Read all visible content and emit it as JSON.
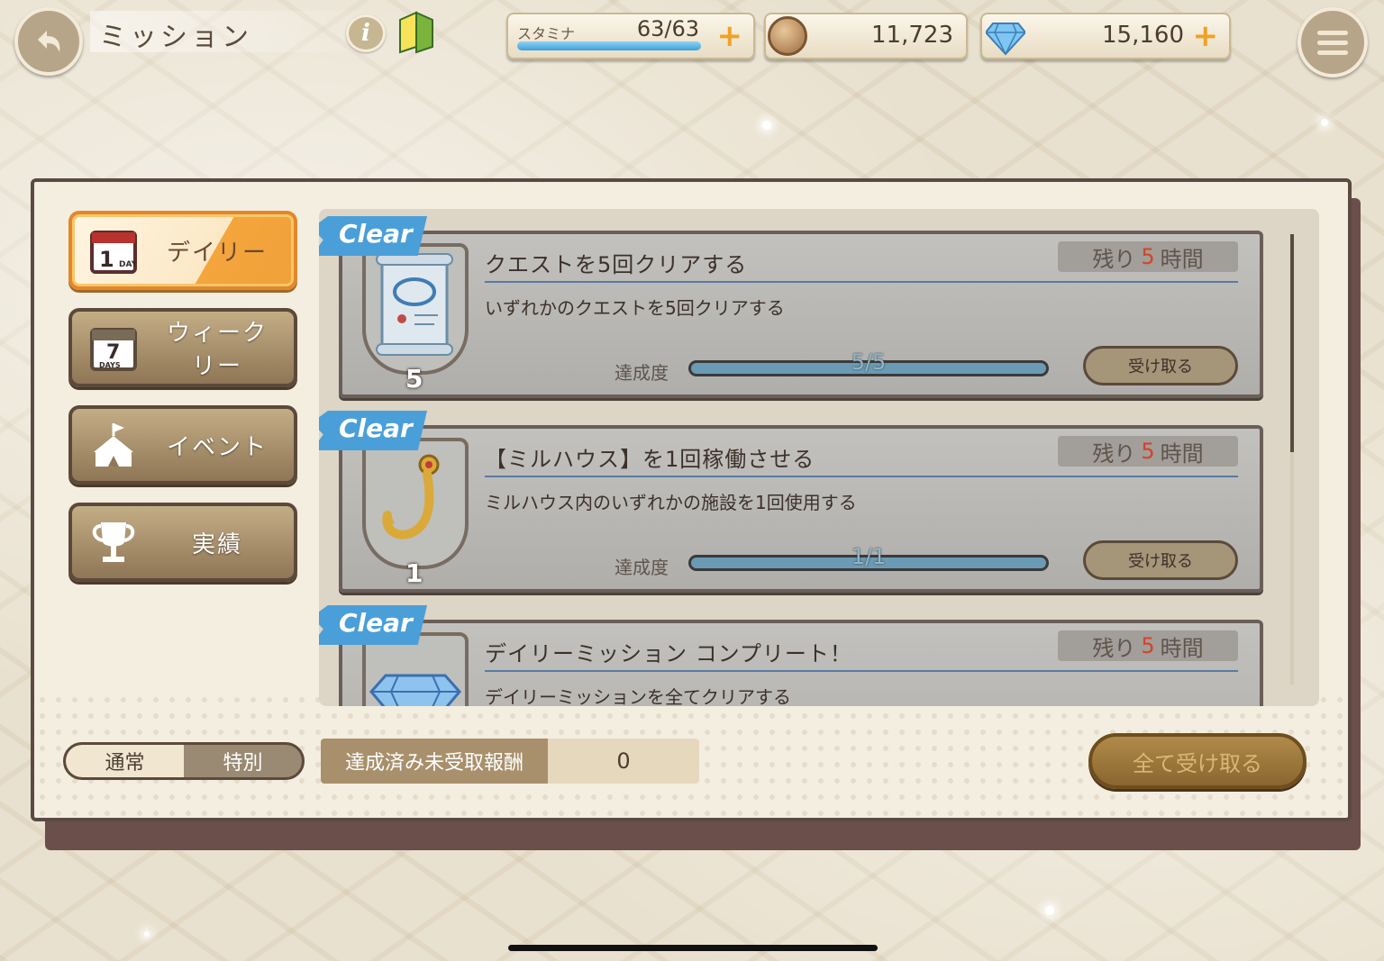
{
  "header": {
    "title": "ミッション",
    "stamina_label": "スタミナ",
    "stamina_value": "63/63",
    "stamina_fraction": 1.0,
    "coins": "11,723",
    "gems": "15,160",
    "plus": "+"
  },
  "tabs": [
    {
      "label": "デイリー",
      "active": true
    },
    {
      "label": "ウィークリー",
      "active": false
    },
    {
      "label": "イベント",
      "active": false
    },
    {
      "label": "実績",
      "active": false
    }
  ],
  "tab_icon_text": {
    "daily_day": "1",
    "daily_unit": "DAY",
    "weekly_day": "7",
    "weekly_unit": "DAYS"
  },
  "missions": [
    {
      "clear": "Clear",
      "title": "クエストを5回クリアする",
      "remain_prefix": "残り",
      "remain_num": "5",
      "remain_suffix": "時間",
      "desc": "いずれかのクエストを5回クリアする",
      "progress_label": "達成度",
      "progress_text": "5/5",
      "progress_fraction": 1.0,
      "reward_count": "5",
      "reward_icon": "scroll-icon",
      "button": "受け取る"
    },
    {
      "clear": "Clear",
      "title": "【ミルハウス】を1回稼働させる",
      "remain_prefix": "残り",
      "remain_num": "5",
      "remain_suffix": "時間",
      "desc": "ミルハウス内のいずれかの施設を1回使用する",
      "progress_label": "達成度",
      "progress_text": "1/1",
      "progress_fraction": 1.0,
      "reward_count": "1",
      "reward_icon": "hook-icon",
      "button": "受け取る"
    },
    {
      "clear": "Clear",
      "title": "デイリーミッション コンプリート！",
      "remain_prefix": "残り",
      "remain_num": "5",
      "remain_suffix": "時間",
      "desc": "デイリーミッションを全てクリアする",
      "reward_icon": "diamond-icon"
    }
  ],
  "bottom": {
    "toggle_normal": "通常",
    "toggle_special": "特別",
    "unclaimed_label": "達成済み未受取報酬",
    "unclaimed_value": "0",
    "claim_all": "全て受け取る"
  },
  "colors": {
    "accent_orange": "#f0a13a",
    "clear_blue": "#4a9fd8",
    "remain_red": "#d2432a"
  }
}
